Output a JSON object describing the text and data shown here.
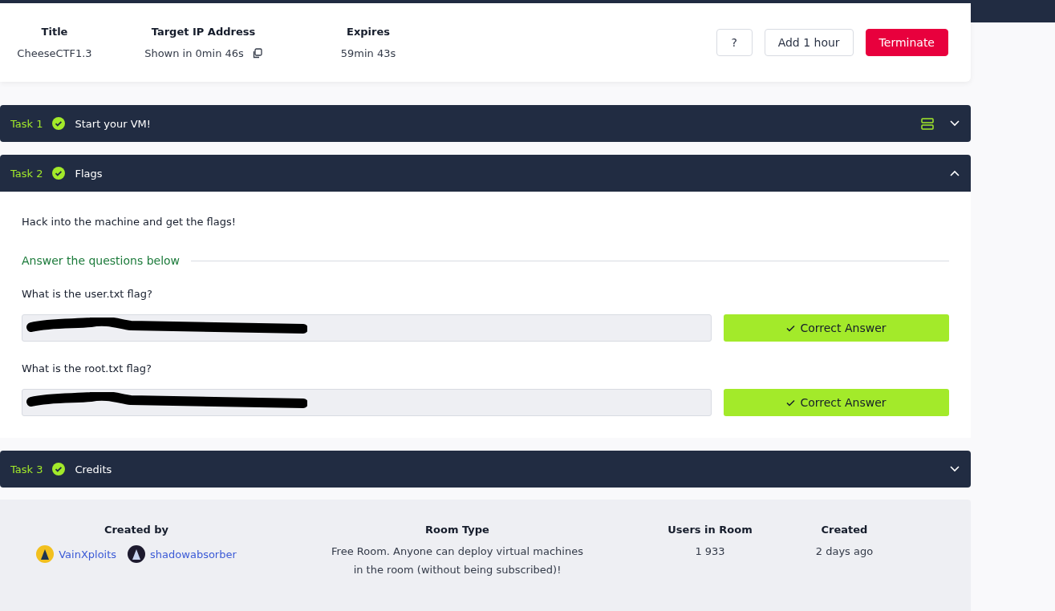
{
  "machine": {
    "columns": [
      {
        "label": "Title",
        "value": "CheeseCTF1.3",
        "copy": false
      },
      {
        "label": "Target IP Address",
        "value": "Shown in 0min 46s",
        "copy": true
      },
      {
        "label": "Expires",
        "value": "59min 43s",
        "copy": false
      }
    ],
    "buttons": [
      {
        "label": "?",
        "kind": "outline"
      },
      {
        "label": "Add 1 hour",
        "kind": "outline"
      },
      {
        "label": "Terminate",
        "kind": "danger"
      }
    ]
  },
  "tasks": [
    {
      "number": "Task 1",
      "title": "Start your VM!",
      "done": true,
      "expanded": false,
      "vm_icon": true
    },
    {
      "number": "Task 2",
      "title": "Flags",
      "done": true,
      "expanded": true,
      "vm_icon": false,
      "description": "Hack into the machine and get the flags!",
      "answers_heading": "Answer the questions below",
      "questions": [
        {
          "question": "What is the user.txt flag?",
          "redacted": true,
          "result": "Correct Answer",
          "correct": true
        },
        {
          "question": "What is the root.txt flag?",
          "redacted": true,
          "result": "Correct Answer",
          "correct": true
        }
      ]
    },
    {
      "number": "Task 3",
      "title": "Credits",
      "done": true,
      "expanded": false,
      "vm_icon": false
    }
  ],
  "room_info": {
    "created_by": {
      "label": "Created by",
      "authors": [
        "VainXploits",
        "shadowabsorber"
      ]
    },
    "room_type": {
      "label": "Room Type",
      "lines": [
        "Free Room. Anyone can deploy virtual machines",
        "in the room (without being subscribed)!"
      ]
    },
    "users": {
      "label": "Users in Room",
      "value": "1 933"
    },
    "created": {
      "label": "Created",
      "value": "2 days ago"
    }
  }
}
